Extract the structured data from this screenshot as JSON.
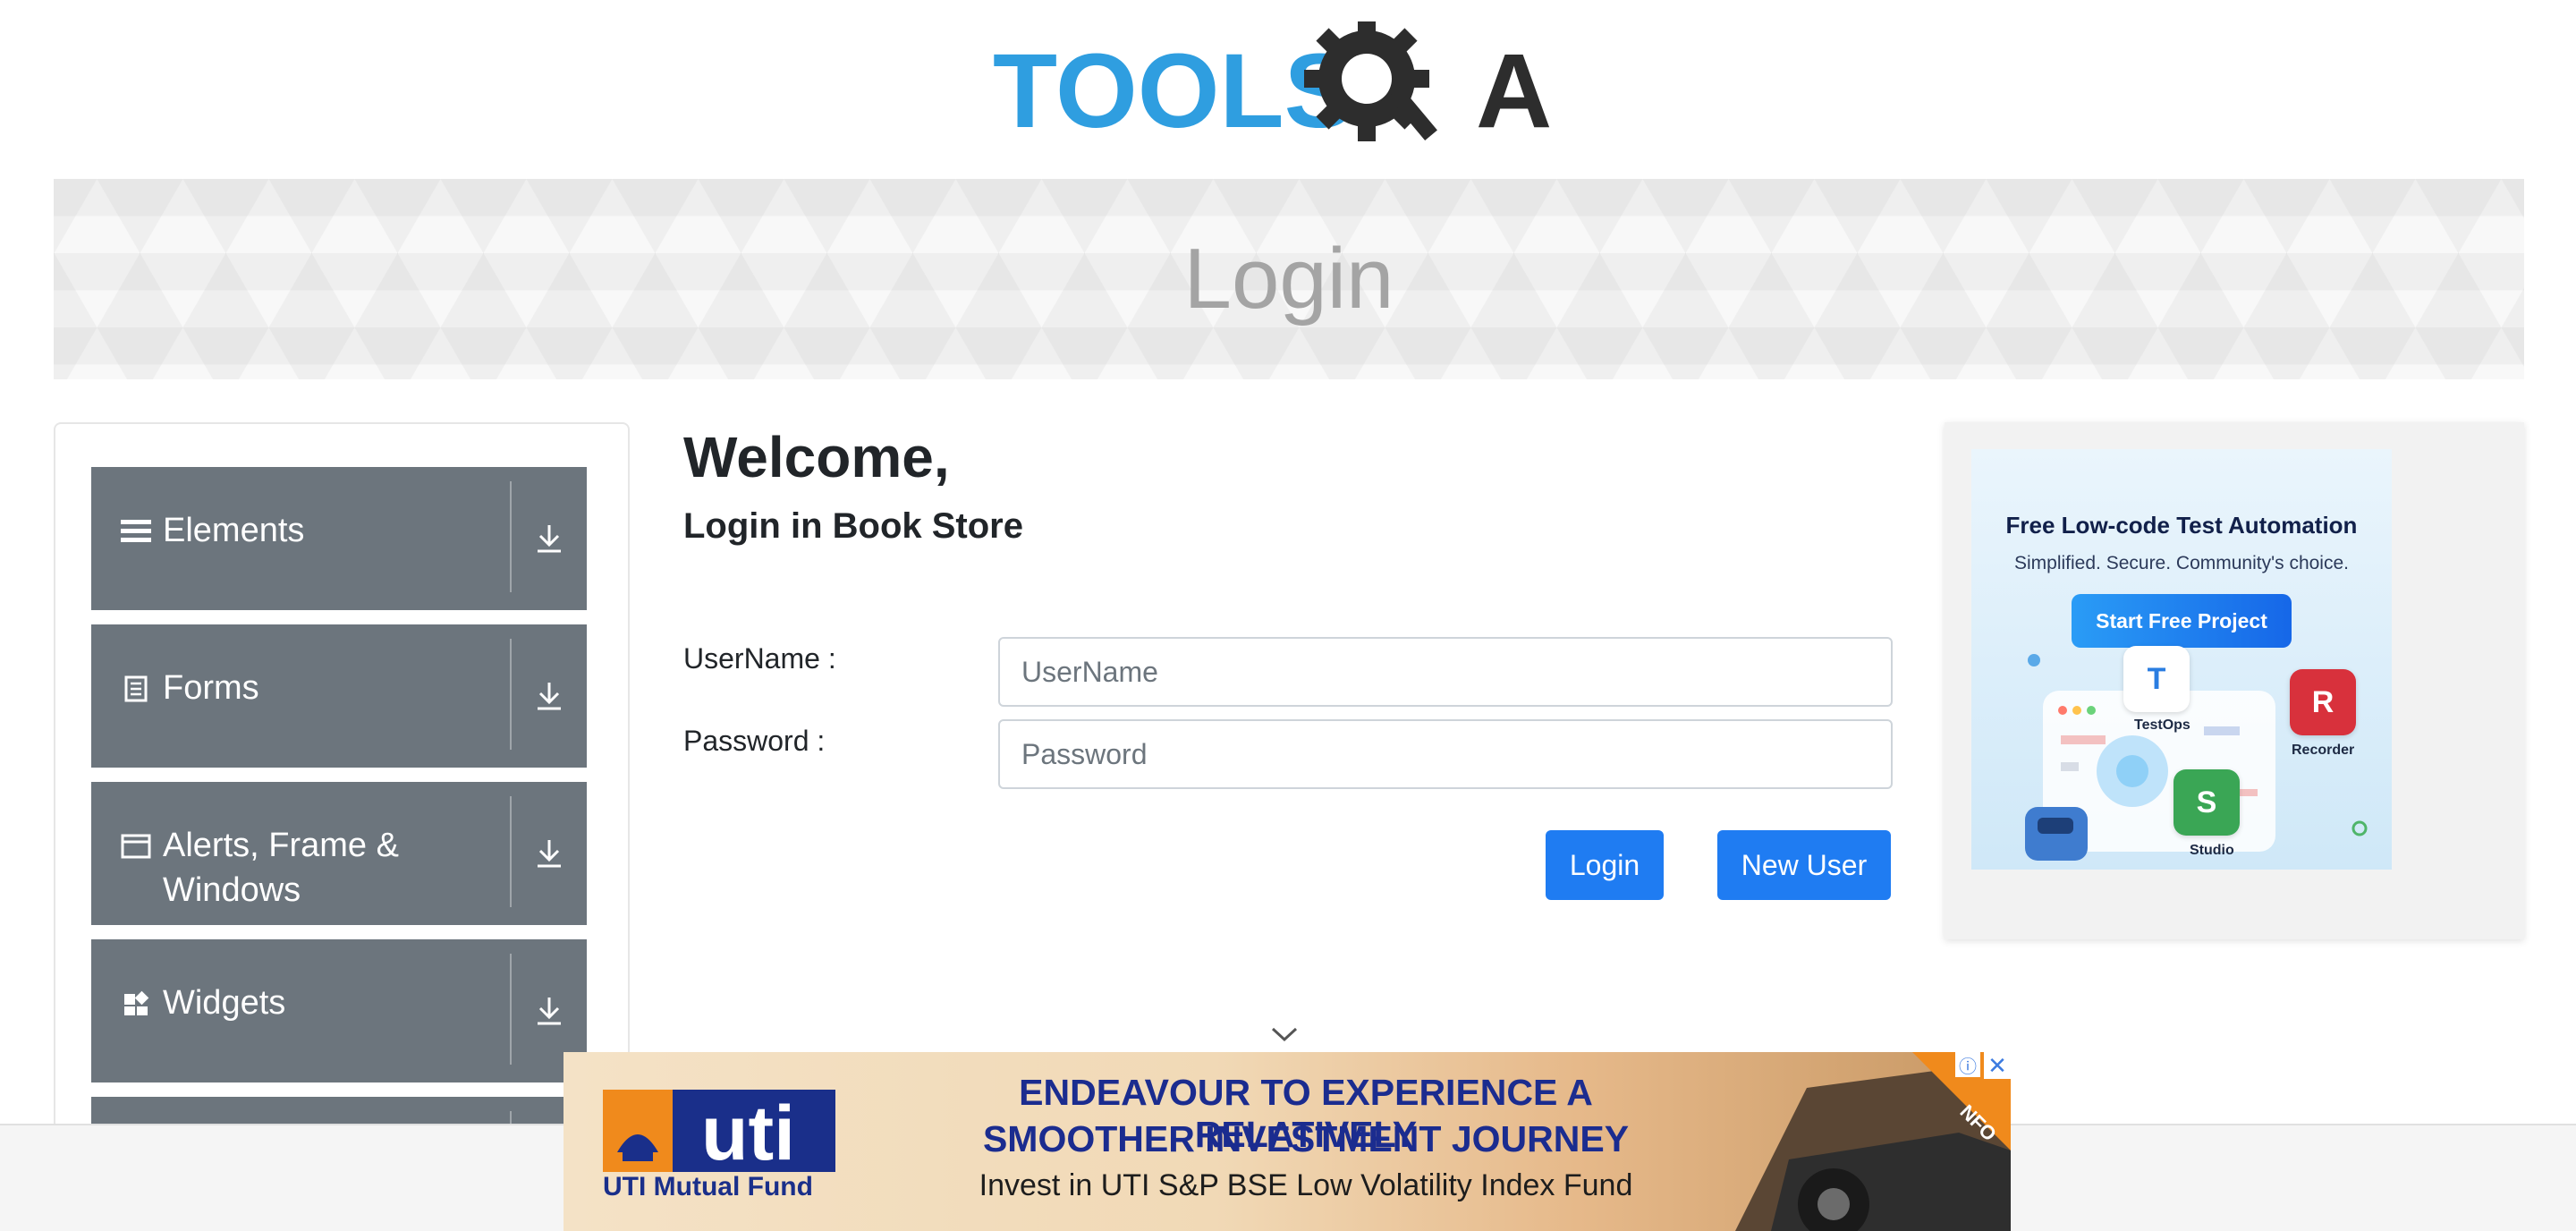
{
  "header": {
    "logo_text_left": "TOOLS",
    "logo_text_right": "A"
  },
  "banner": {
    "title": "Login"
  },
  "sidebar": {
    "items": [
      {
        "label": "Elements",
        "icon": "hamburger-icon"
      },
      {
        "label": "Forms",
        "icon": "document-icon"
      },
      {
        "label": "Alerts, Frame &",
        "label2": "Windows",
        "icon": "window-icon"
      },
      {
        "label": "Widgets",
        "icon": "widgets-icon"
      }
    ],
    "download_icon": "download-icon"
  },
  "main": {
    "welcome": "Welcome,",
    "subtitle": "Login in Book Store",
    "username_label": "UserName :",
    "username_placeholder": "UserName",
    "password_label": "Password :",
    "password_placeholder": "Password",
    "login_button": "Login",
    "new_user_button": "New User"
  },
  "side_ad": {
    "headline": "Free Low-code Test Automation",
    "subline": "Simplified. Secure. Community's choice.",
    "cta": "Start Free Project",
    "tiles": [
      {
        "letter": "T",
        "label": "TestOps"
      },
      {
        "letter": "R",
        "label": "Recorder"
      },
      {
        "letter": "S",
        "label": "Studio"
      }
    ]
  },
  "bottom_ad": {
    "brand": "UTI Mutual Fund",
    "logo_text": "uti",
    "line1": "ENDEAVOUR TO EXPERIENCE A RELATIVELY",
    "line2": "SMOOTHER INVESTMENT JOURNEY",
    "line3": "Invest in UTI S&P BSE Low Volatility Index Fund",
    "corner_badge": "NFO",
    "info_icon": "ⓘ",
    "close_icon": "✕"
  },
  "colors": {
    "logo_blue": "#2f9ee0",
    "logo_dark": "#2d2d2d",
    "menu_card": "#6c757d",
    "primary_button": "#1f7cf2"
  }
}
